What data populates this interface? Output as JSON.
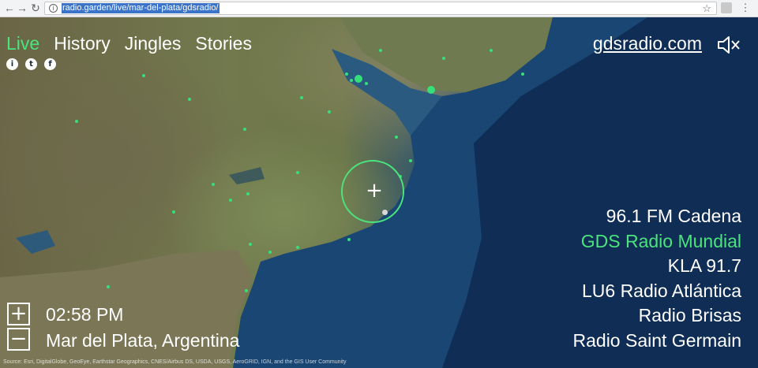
{
  "browser": {
    "url": "radio.garden/live/mar-del-plata/gdsradio/",
    "back_icon": "arrow-left-icon",
    "forward_icon": "arrow-right-icon",
    "reload_icon": "reload-icon",
    "info_icon": "i",
    "bookmark_icon": "☆",
    "menu_icon": "⋮"
  },
  "nav": {
    "tabs": [
      {
        "label": "Live",
        "active": true
      },
      {
        "label": "History",
        "active": false
      },
      {
        "label": "Jingles",
        "active": false
      },
      {
        "label": "Stories",
        "active": false
      }
    ],
    "social": [
      "i",
      "t",
      "f"
    ]
  },
  "header": {
    "site_link": "gdsradio.com",
    "volume_icon": "speaker-muted-icon"
  },
  "stations": [
    {
      "label": "96.1 FM Cadena",
      "active": false
    },
    {
      "label": "GDS Radio Mundial",
      "active": true
    },
    {
      "label": "KLA 91.7",
      "active": false
    },
    {
      "label": "LU6 Radio Atlántica",
      "active": false
    },
    {
      "label": "Radio Brisas",
      "active": false
    },
    {
      "label": "Radio Saint Germain",
      "active": false
    }
  ],
  "controls": {
    "zoom_in": "+",
    "zoom_out": "−",
    "time": "02:58 PM",
    "location": "Mar del Plata, Argentina"
  },
  "map": {
    "target_symbol": "+",
    "attribution": "Source: Esri, DigitalGlobe, GeoEye, Earthstar Geographics, CNES/Airbus DS, USDA, USGS, AeroGRID, IGN, and the GIS User Community"
  },
  "colors": {
    "accent": "#4be37c",
    "text": "#ffffff",
    "ocean": "#0e2a50"
  }
}
